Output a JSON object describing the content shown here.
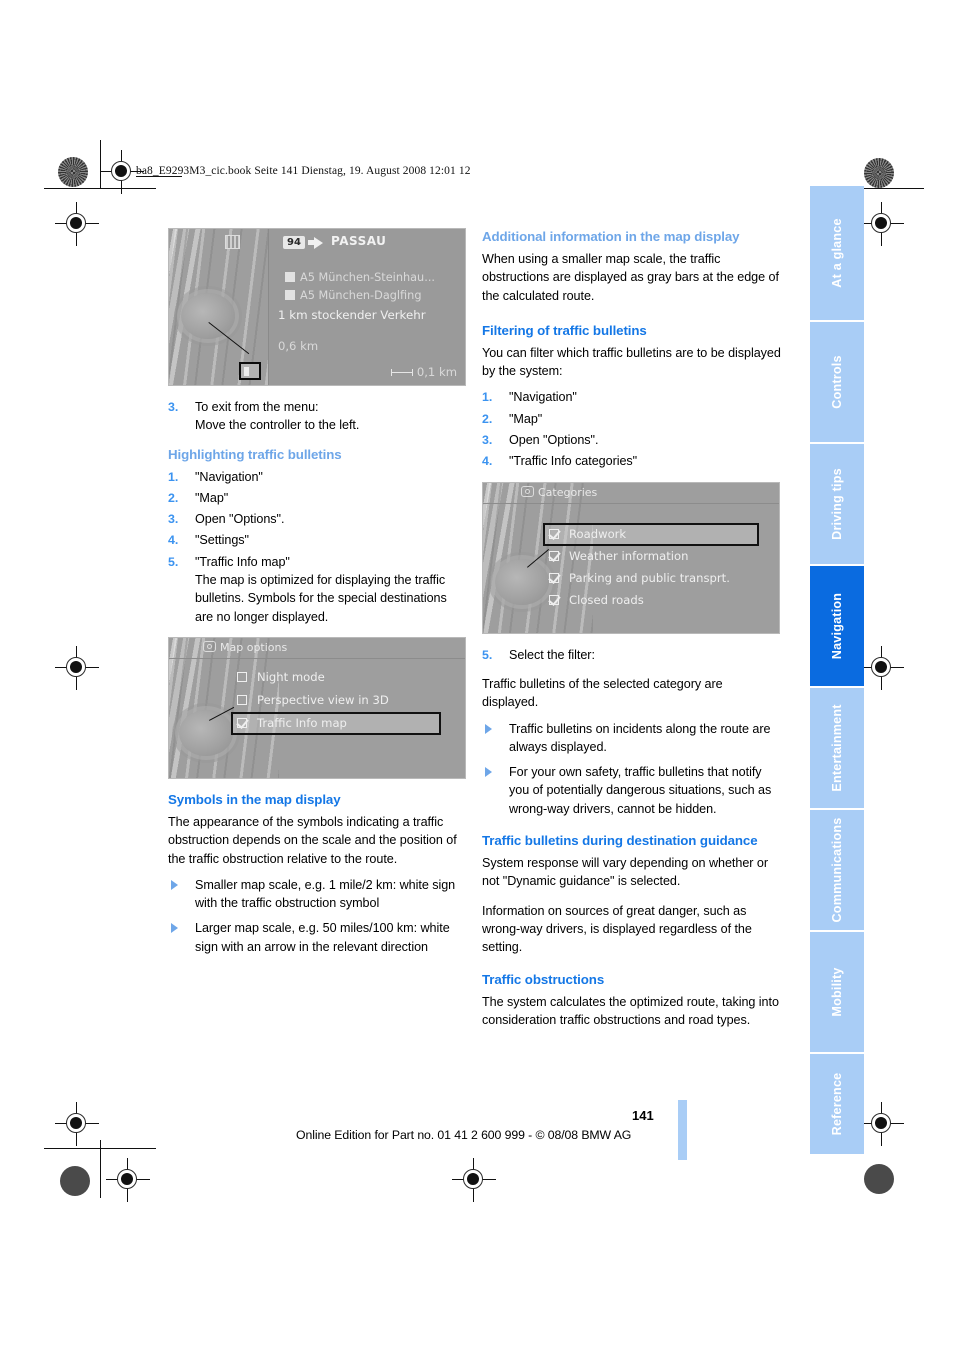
{
  "header": {
    "file_note": "ba8_E9293M3_cic.book  Seite 141  Dienstag, 19. August 2008  12:01 12"
  },
  "footer": {
    "page_number": "141",
    "imprint": "Online Edition for Part no. 01 41 2 600 999 - © 08/08 BMW AG"
  },
  "rail": {
    "tabs": [
      {
        "label": "At a glance",
        "active": false
      },
      {
        "label": "Controls",
        "active": false
      },
      {
        "label": "Driving tips",
        "active": false
      },
      {
        "label": "Navigation",
        "active": true
      },
      {
        "label": "Entertainment",
        "active": false
      },
      {
        "label": "Communications",
        "active": false
      },
      {
        "label": "Mobility",
        "active": false
      },
      {
        "label": "Reference",
        "active": false
      }
    ],
    "active_color": "#0a6be0",
    "inactive_color": "#a9cdf6"
  },
  "colors": {
    "heading_light_blue": "#6ea6e8",
    "heading_strong_blue": "#1477e6",
    "list_number_blue": "#3b93f0",
    "body_text": "#000000"
  },
  "screenshot_map": {
    "road_shield": "94",
    "destination": "PASSAU",
    "bulletins": [
      "A5 München-Steinhau...",
      "A5 München-Daglfing"
    ],
    "status": "1 km stockender Verkehr",
    "distance": "0,6 km",
    "scale": "0,1 km"
  },
  "screenshot_map_options": {
    "title": "Map options",
    "items": [
      {
        "label": "Night mode",
        "checked": false,
        "selected": false
      },
      {
        "label": "Perspective view in 3D",
        "checked": false,
        "selected": false
      },
      {
        "label": "Traffic Info map",
        "checked": true,
        "selected": true
      }
    ]
  },
  "screenshot_categories": {
    "title": "Categories",
    "items": [
      {
        "label": "Roadwork",
        "checked": true,
        "selected": true
      },
      {
        "label": "Weather information",
        "checked": true,
        "selected": false
      },
      {
        "label": "Parking and public transprt.",
        "checked": true,
        "selected": false
      },
      {
        "label": "Closed roads",
        "checked": true,
        "selected": false
      }
    ]
  },
  "left_column": {
    "step3": {
      "num": "3.",
      "line1": "To exit from the menu:",
      "line2": "Move the controller to the left."
    },
    "highlighting": {
      "heading": "Highlighting traffic bulletins",
      "steps": [
        {
          "num": "1.",
          "text": "\"Navigation\""
        },
        {
          "num": "2.",
          "text": "\"Map\""
        },
        {
          "num": "3.",
          "text": "Open \"Options\"."
        },
        {
          "num": "4.",
          "text": "\"Settings\""
        },
        {
          "num": "5.",
          "text": "\"Traffic Info map\"",
          "sub": "The map is optimized for displaying the traffic bulletins. Symbols for the special destinations are no longer displayed."
        }
      ]
    },
    "symbols": {
      "heading": "Symbols in the map display",
      "intro": "The appearance of the symbols indicating a traffic obstruction depends on the scale and the position of the traffic obstruction relative to the route.",
      "bullets": [
        "Smaller map scale, e.g. 1 mile/2 km: white sign with the traffic obstruction symbol",
        "Larger map scale, e.g. 50 miles/100 km: white sign with an arrow in the relevant direction"
      ]
    }
  },
  "right_column": {
    "additional": {
      "heading": "Additional information in the map display",
      "body": "When using a smaller map scale, the traffic obstructions are displayed as gray bars at the edge of the calculated route."
    },
    "filtering": {
      "heading": "Filtering of traffic bulletins",
      "intro": "You can filter which traffic bulletins are to be displayed by the system:",
      "steps": [
        {
          "num": "1.",
          "text": "\"Navigation\""
        },
        {
          "num": "2.",
          "text": "\"Map\""
        },
        {
          "num": "3.",
          "text": "Open \"Options\"."
        },
        {
          "num": "4.",
          "text": "\"Traffic Info categories\""
        }
      ],
      "step5": {
        "num": "5.",
        "text": "Select the filter:"
      },
      "after": "Traffic bulletins of the selected category are displayed.",
      "bullets": [
        "Traffic bulletins on incidents along the route are always displayed.",
        "For your own safety, traffic bulletins that notify you of potentially dangerous situations, such as wrong-way drivers, cannot be hidden."
      ]
    },
    "guidance": {
      "heading": "Traffic bulletins during destination guidance",
      "p1": "System response will vary depending on whether or not \"Dynamic guidance\" is selected.",
      "p2": "Information on sources of great danger, such as wrong-way drivers, is displayed regardless of the setting."
    },
    "obstructions": {
      "heading": "Traffic obstructions",
      "body": "The system calculates the optimized route, taking into consideration traffic obstructions and road types."
    }
  }
}
